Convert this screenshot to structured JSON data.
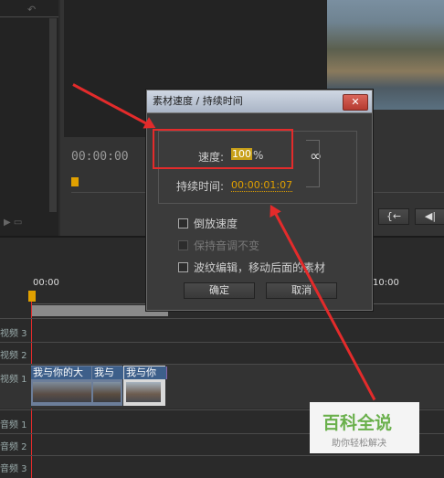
{
  "dialog": {
    "title": "素材速度 / 持续时间",
    "close_glyph": "✕",
    "speed_label": "速度:",
    "speed_value": "100",
    "speed_unit": "%",
    "link_glyph": "∞",
    "duration_label": "持续时间:",
    "duration_value": "00:00:01:07",
    "options": [
      {
        "label": "倒放速度",
        "checked": false,
        "enabled": true
      },
      {
        "label": "保持音调不变",
        "checked": false,
        "enabled": false
      },
      {
        "label": "波纹编辑，移动后面的素材",
        "checked": false,
        "enabled": true
      }
    ],
    "ok_label": "确定",
    "cancel_label": "取消"
  },
  "monitor": {
    "timecode": "00:00:00",
    "right_button_1": "{←",
    "right_button_2": "◀|"
  },
  "timeline": {
    "ruler_start": "00:00",
    "ruler_end": "10:00",
    "tracks_video": [
      "视频 3",
      "视频 2",
      "视频 1"
    ],
    "tracks_audio": [
      "音频 1",
      "音频 2",
      "音频 3"
    ],
    "clip_labels": [
      "我与你的大",
      "我与",
      "我与你"
    ]
  },
  "watermark": {
    "title": "百科全说",
    "subtitle": "助你轻松解决"
  },
  "colors": {
    "accent_red": "#e32b2b",
    "timecode_orange": "#e0a000",
    "clip_blue": "#3d5f8a",
    "watermark_green": "#6ab04c"
  }
}
